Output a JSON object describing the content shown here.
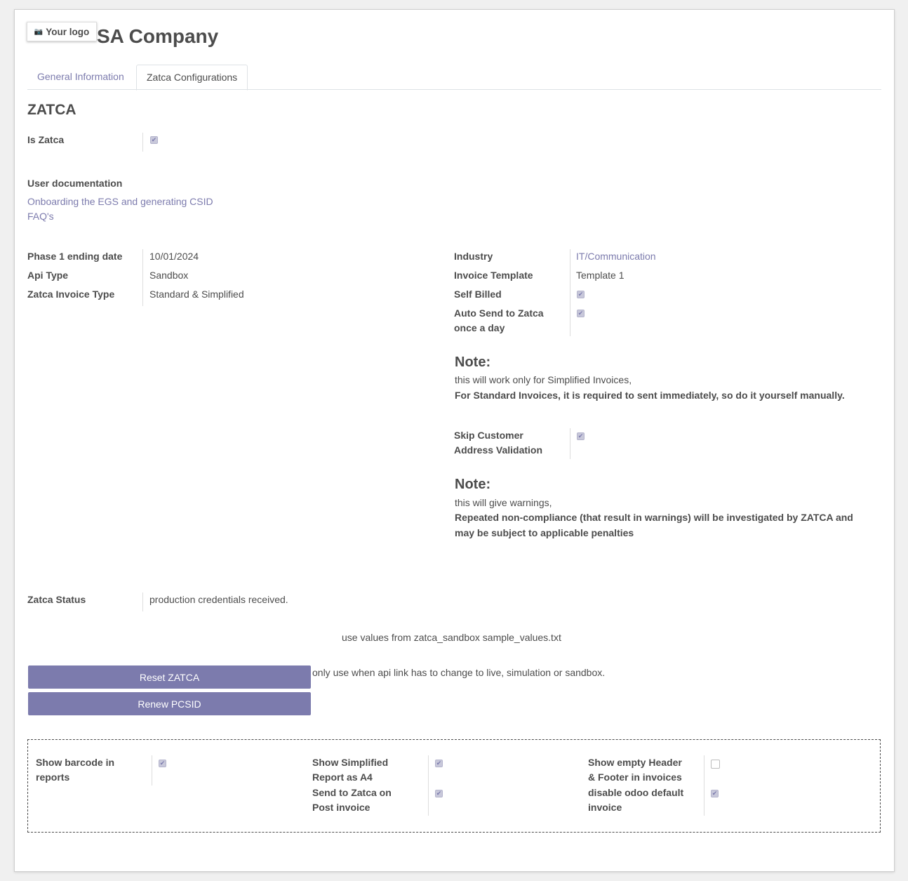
{
  "header": {
    "logo_label": "Your logo",
    "logo_icon": "camera-icon",
    "company_name": "SA Company"
  },
  "tabs": [
    {
      "label": "General Information"
    },
    {
      "label": "Zatca Configurations",
      "active": true
    }
  ],
  "section_title": "ZATCA",
  "is_zatca": {
    "label": "Is Zatca",
    "checked": true
  },
  "docs": {
    "title": "User documentation",
    "links": [
      "Onboarding the EGS and generating CSID",
      "FAQ's"
    ]
  },
  "left_fields": [
    {
      "label": "Phase 1 ending date",
      "value": "10/01/2024"
    },
    {
      "label": "Api Type",
      "value": "Sandbox"
    },
    {
      "label": "Zatca Invoice Type",
      "value": "Standard & Simplified"
    }
  ],
  "right_fields": {
    "industry": {
      "label": "Industry",
      "value": "IT/Communication"
    },
    "invoice_template": {
      "label": "Invoice Template",
      "value": "Template 1"
    },
    "self_billed": {
      "label": "Self Billed",
      "checked": true
    },
    "auto_send": {
      "label_1": "Auto Send to Zatca",
      "label_2": "once a day",
      "checked": true
    },
    "skip_validation": {
      "label_1": "Skip Customer",
      "label_2": "Address Validation",
      "checked": true
    }
  },
  "note1": {
    "heading": "Note:",
    "text": "this will work only for Simplified Invoices,",
    "bold": "For Standard Invoices, it is required to sent immediately, so do it yourself manually."
  },
  "note2": {
    "heading": "Note:",
    "text": "this will give warnings,",
    "bold_1": "Repeated non-compliance (that result in warnings) will be investigated by ZATCA and",
    "bold_2": "may be subject to applicable penalties"
  },
  "status": {
    "label": "Zatca Status",
    "value": "production credentials received."
  },
  "sample_hint": "use values from zatca_sandbox sample_values.txt",
  "buttons": {
    "reset": "Reset ZATCA",
    "renew": "Renew PCSID",
    "reset_hint": "only use when api link has to change to live, simulation or sandbox."
  },
  "options": {
    "barcode": {
      "label_1": "Show barcode in",
      "label_2": "reports",
      "checked": true
    },
    "simplified_a4": {
      "label_1": "Show Simplified",
      "label_2": "Report as A4",
      "checked": true
    },
    "send_on_post": {
      "label_1": "Send to Zatca on",
      "label_2": "Post invoice",
      "checked": true
    },
    "empty_header": {
      "label_1": "Show empty Header",
      "label_2": "& Footer in invoices",
      "checked": false
    },
    "disable_default": {
      "label_1": "disable odoo default",
      "label_2": "invoice",
      "checked": true
    }
  },
  "colors": {
    "accent": "#7c7bad",
    "text": "#4c4c4c",
    "checkbox_fill": "#c8c8da"
  }
}
